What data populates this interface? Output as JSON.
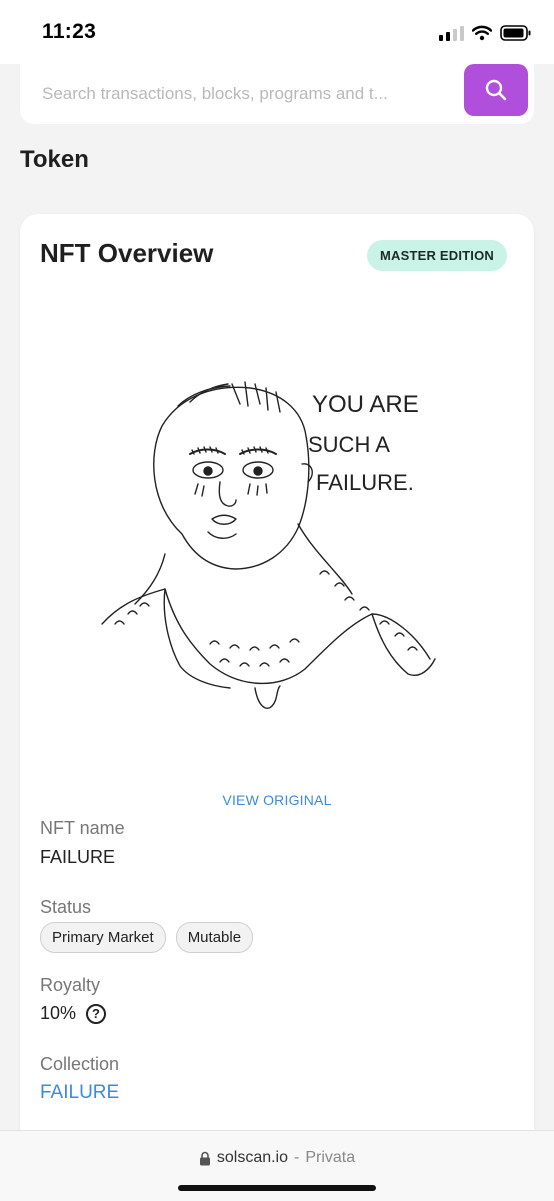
{
  "status_bar": {
    "time": "11:23",
    "icons": [
      "cellular-signal-icon",
      "wifi-icon",
      "battery-icon"
    ]
  },
  "search": {
    "placeholder": "Search transactions, blocks, programs and t...",
    "icon": "search-icon",
    "button_color": "#b14fdd"
  },
  "page": {
    "title": "Token"
  },
  "nft_overview": {
    "title": "NFT Overview",
    "badge": "MASTER EDITION",
    "image": {
      "caption_line1": "YOU ARE",
      "caption_line2": "SUCH A",
      "caption_line3": "FAILURE."
    },
    "view_original": "VIEW ORIGINAL",
    "fields": {
      "name_label": "NFT name",
      "name_value": "FAILURE",
      "status_label": "Status",
      "status_tags": [
        "Primary Market",
        "Mutable"
      ],
      "royalty_label": "Royalty",
      "royalty_value": "10%",
      "collection_label": "Collection",
      "collection_value": "FAILURE"
    }
  },
  "browser": {
    "domain": "solscan.io",
    "separator": "-",
    "mode": "Privata",
    "icon": "lock-icon"
  },
  "colors": {
    "accent": "#b14fdd",
    "link": "#3a8be0",
    "badge_bg": "#c9f3e7"
  }
}
